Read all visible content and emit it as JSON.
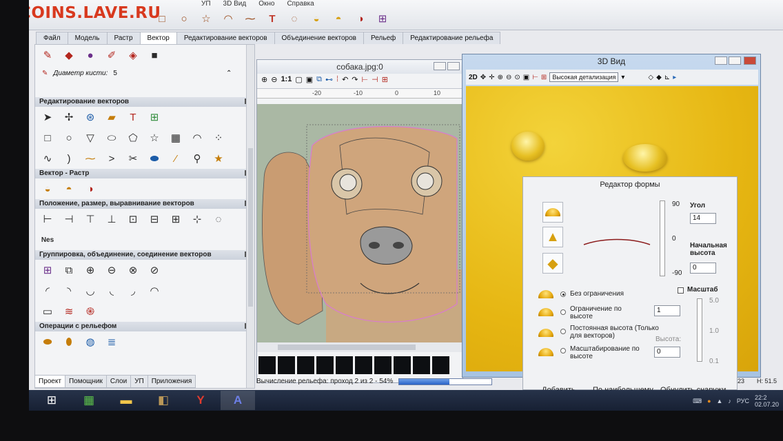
{
  "watermark": "COINS.LAVE.RU",
  "menu": [
    "УП",
    "3D Вид",
    "Окно",
    "Справка"
  ],
  "main_tabs": [
    "Файл",
    "Модель",
    "Растр",
    "Вектор",
    "Редактирование векторов",
    "Объединение векторов",
    "Рельеф",
    "Редактирование рельефа"
  ],
  "active_main_tab": "Вектор",
  "left_panel": {
    "brush_label": "Диаметр кисти:",
    "brush_value": "5",
    "sections": [
      "Редактирование векторов",
      "Вектор - Растр",
      "Положение, размер, выравнивание векторов",
      "Группировка, объединение, соединение векторов",
      "Операции с рельефом"
    ]
  },
  "bottom_tabs": [
    "Проект",
    "Помощник",
    "Слои",
    "УП",
    "Приложения"
  ],
  "image_window": {
    "title": "собака.jpg:0",
    "zoom_label": "1:1",
    "ruler_ticks": [
      "-20",
      "-10",
      "0",
      "10"
    ]
  },
  "status": {
    "text": "Вычисление рельефа: проход 2 из 2  - 54%",
    "progress": 0.54
  },
  "view3d": {
    "title": "3D Вид",
    "mode_label": "2D",
    "detail_select": "Высокая детализация"
  },
  "shape_editor": {
    "title": "Редактор формы",
    "angle_label": "Угол",
    "angle_value": "14",
    "angle_scale": [
      "90",
      "0",
      "-90"
    ],
    "start_height_label": "Начальная высота",
    "start_height_value": "0",
    "scale_checkbox": "Масштаб",
    "scale_values": [
      "5.0",
      "1.0",
      "0.1"
    ],
    "options": [
      "Без ограничения",
      "Ограничение по высоте",
      "Постоянная высота (Только для векторов)",
      "Масштабирование по высоте"
    ],
    "selected_option": 0,
    "limit_value": "1",
    "height_label": "Высота:",
    "height_value": "0",
    "buttons": [
      "Добавить",
      "По наибольшему",
      "Обнулить снаружи"
    ]
  },
  "right_status": {
    "left_value": "23",
    "right_value": "Н: 51.5"
  },
  "taskbar": {
    "lang": "РУС",
    "time": "22:2",
    "date": "02.07.20"
  }
}
